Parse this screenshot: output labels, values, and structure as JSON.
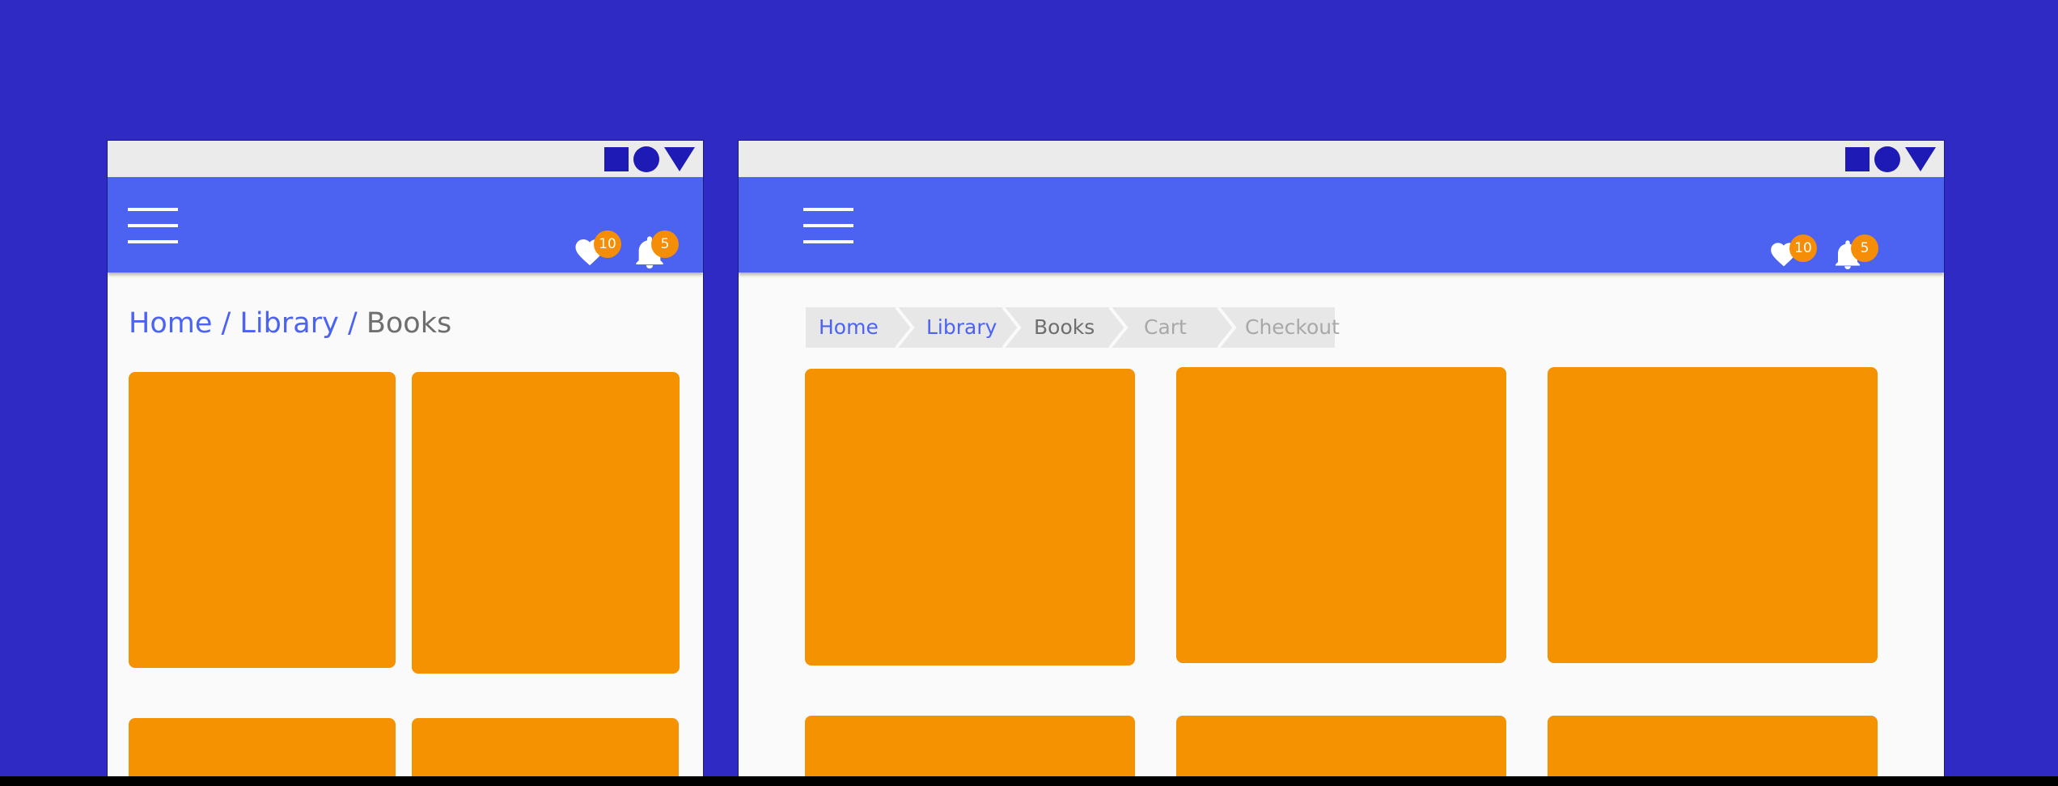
{
  "colors": {
    "page_background": "#2f2ac4",
    "appbar": "#4c63f2",
    "statusbar": "#ebebeb",
    "status_icons": "#1e1ab5",
    "card": "#f59202",
    "badge": "#f58e06",
    "link": "#4c63f2",
    "current": "#6e6e6e",
    "disabled": "#a8a8a8"
  },
  "icons": {
    "status": [
      "square-icon",
      "circle-icon",
      "triangle-icon"
    ],
    "menu": "hamburger-menu-icon",
    "favorites": "heart-icon",
    "notifications": "bell-icon"
  },
  "mobile": {
    "favorites_count": "10",
    "notifications_count": "5",
    "breadcrumb": {
      "links": [
        "Home",
        "Library"
      ],
      "current": "Books",
      "separator": "/"
    }
  },
  "desktop": {
    "favorites_count": "10",
    "notifications_count": "5",
    "breadcrumb": {
      "active": [
        "Home",
        "Library"
      ],
      "current": "Books",
      "upcoming": [
        "Cart",
        "Checkout"
      ]
    }
  }
}
